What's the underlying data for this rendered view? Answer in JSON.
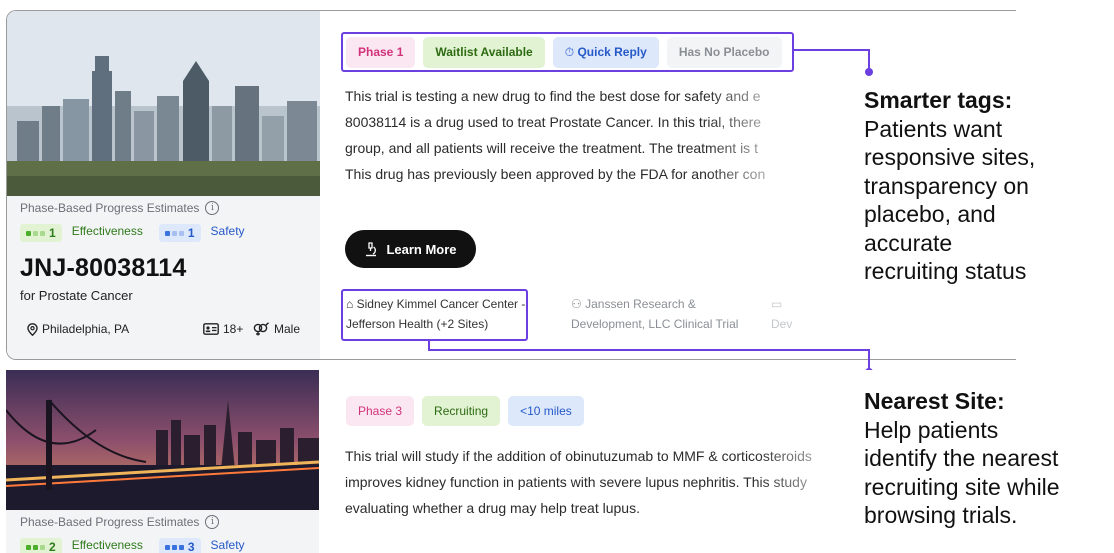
{
  "trial1": {
    "image_alt": "city skyline photo",
    "progress_label": "Phase-Based Progress Estimates",
    "effectiveness": {
      "level": 1,
      "label": "Effectiveness"
    },
    "safety": {
      "level": 1,
      "label": "Safety"
    },
    "drug_name": "JNJ-80038114",
    "condition": "for Prostate Cancer",
    "location": "Philadelphia, PA",
    "age": "18+",
    "sex": "Male",
    "tags": [
      "Phase 1",
      "Waitlist Available",
      "Quick Reply",
      "Has No Placebo"
    ],
    "description_lines": [
      "This trial is testing a new drug to find the best dose for safety and e",
      "80038114 is a drug used to treat Prostate Cancer. In this trial, there",
      "group, and all patients will receive the treatment. The treatment is t",
      "This drug has previously been approved by the FDA for another con"
    ],
    "learn_more": "Learn More",
    "site1": [
      "Sidney Kimmel Cancer Center -",
      "Jefferson Health (+2 Sites)"
    ],
    "site2": [
      "Janssen Research &",
      "Development, LLC Clinical Trial"
    ],
    "site3": [
      "Dev"
    ]
  },
  "trial2": {
    "progress_label": "Phase-Based Progress Estimates",
    "effectiveness": {
      "level": 2,
      "label": "Effectiveness"
    },
    "safety": {
      "level": 3,
      "label": "Safety"
    },
    "tags": [
      "Phase 3",
      "Recruiting",
      "<10 miles"
    ],
    "description_lines": [
      "This trial will study if the addition of obinutuzumab to MMF & corticosteroids",
      "improves kidney function in patients with severe lupus nephritis. This study",
      "evaluating whether a drug may help treat lupus."
    ]
  },
  "callouts": {
    "smarter_tags": {
      "heading": "Smarter tags:",
      "lines": [
        "Patients want",
        "responsive sites,",
        "transparency on",
        "placebo, and",
        "accurate",
        "recruiting status"
      ]
    },
    "nearest_site": {
      "heading": "Nearest Site:",
      "lines": [
        "Help patients",
        "identify the nearest",
        "recruiting site while",
        "browsing trials."
      ]
    }
  },
  "colors": {
    "accent": "#6b3fe0",
    "green": "#2f7a1a",
    "blue": "#2659c8",
    "pink": "#d0337a"
  }
}
